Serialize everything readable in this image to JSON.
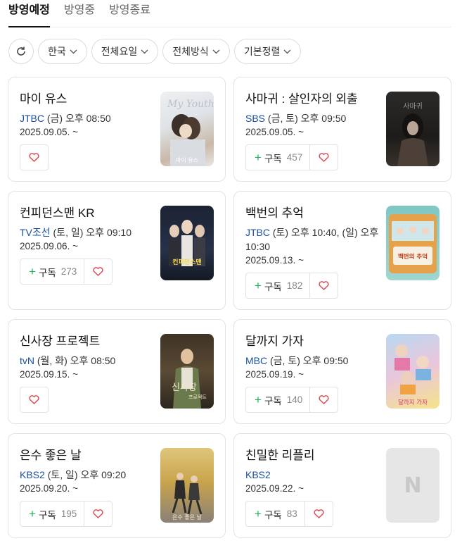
{
  "tabs": [
    "방영예정",
    "방영중",
    "방영종료"
  ],
  "filters": {
    "refresh_icon": "refresh-icon",
    "country": "한국",
    "day": "전체요일",
    "method": "전체방식",
    "sort": "기본정렬"
  },
  "subscribe_label": "구독",
  "cards": [
    {
      "title": "마이 유스",
      "channel": "JTBC",
      "schedule": " (금) 오후 08:50",
      "date": "2025.09.05. ~",
      "subscribers": "",
      "poster_text": "마이 유스",
      "poster_script": "My Youth"
    },
    {
      "title": "사마귀 : 살인자의 외출",
      "channel": "SBS",
      "schedule": " (금, 토) 오후 09:50",
      "date": "2025.09.05. ~",
      "subscribers": "457",
      "poster_text": "",
      "poster_script": "사마귀"
    },
    {
      "title": "컨피던스맨 KR",
      "channel": "TV조선",
      "schedule": " (토, 일) 오후 09:10",
      "date": "2025.09.06. ~",
      "subscribers": "273",
      "poster_text": "컨피던스맨",
      "poster_script": ""
    },
    {
      "title": "백번의 추억",
      "channel": "JTBC",
      "schedule": " (토) 오후 10:40, (일) 오후 10:30",
      "date": "2025.09.13. ~",
      "subscribers": "182",
      "poster_text": "백번의 추억",
      "poster_script": ""
    },
    {
      "title": "신사장 프로젝트",
      "channel": "tvN",
      "schedule": " (월, 화) 오후 08:50",
      "date": "2025.09.15. ~",
      "subscribers": "",
      "poster_text": "프로젝트",
      "poster_script": "신사장"
    },
    {
      "title": "달까지 가자",
      "channel": "MBC",
      "schedule": " (금, 토) 오후 09:50",
      "date": "2025.09.19. ~",
      "subscribers": "140",
      "poster_text": "달까지 가자",
      "poster_script": ""
    },
    {
      "title": "은수 좋은 날",
      "channel": "KBS2",
      "schedule": " (토, 일) 오후 09:20",
      "date": "2025.09.20. ~",
      "subscribers": "195",
      "poster_text": "은수 좋은 날",
      "poster_script": ""
    },
    {
      "title": "친밀한 리플리",
      "channel": "KBS2",
      "schedule": "",
      "date": "2025.09.22. ~",
      "subscribers": "83",
      "poster_text": "",
      "poster_script": "N"
    }
  ],
  "colors": {
    "channel": "#1a4fa0",
    "plus": "#23b05b",
    "heart": "#e0454f"
  }
}
